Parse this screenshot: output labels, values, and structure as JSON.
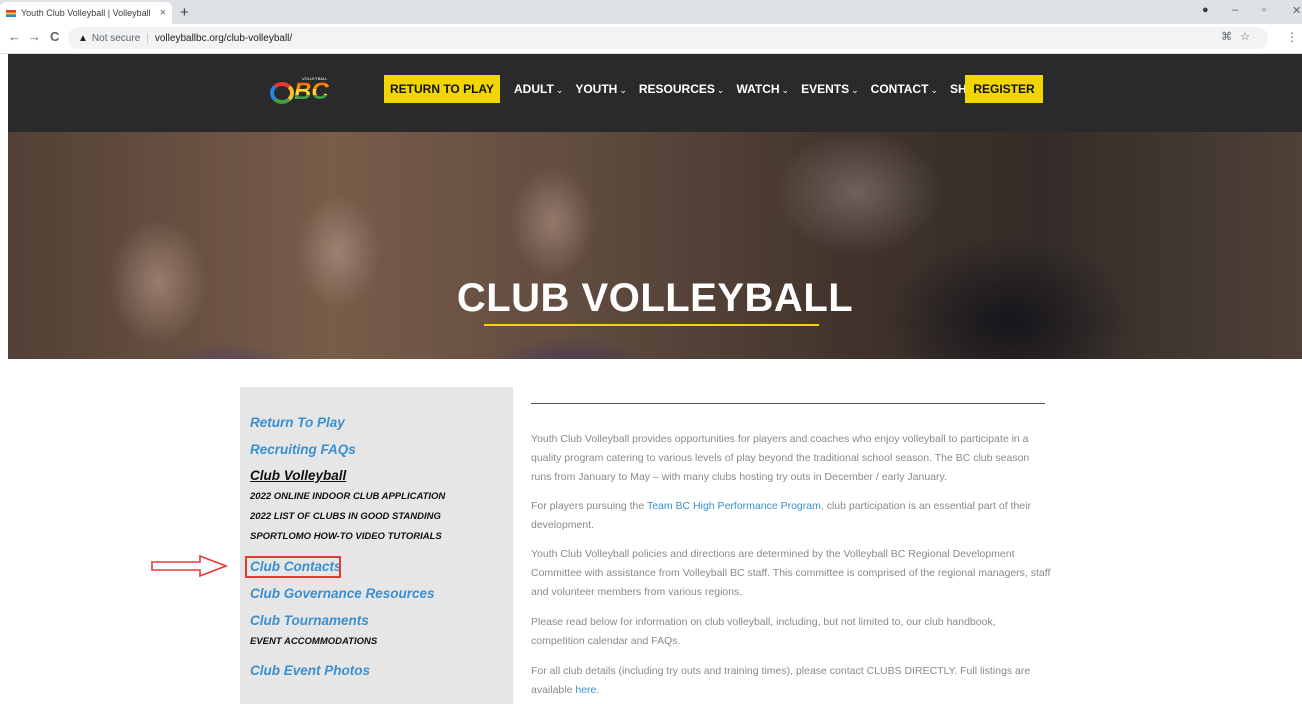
{
  "browser": {
    "tab_title": "Youth Club Volleyball | Volleyball",
    "new_tab": "+",
    "close_tab": "×",
    "not_secure": "Not secure",
    "url": "volleyballbc.org/club-volleyball/"
  },
  "header": {
    "logo_text": "BC",
    "logo_small": "VOLLEYBALL",
    "return_to_play": "RETURN TO PLAY",
    "menu": [
      {
        "label": "ADULT",
        "has_dropdown": true
      },
      {
        "label": "YOUTH",
        "has_dropdown": true
      },
      {
        "label": "RESOURCES",
        "has_dropdown": true
      },
      {
        "label": "WATCH",
        "has_dropdown": true
      },
      {
        "label": "EVENTS",
        "has_dropdown": true
      },
      {
        "label": "CONTACT",
        "has_dropdown": true
      },
      {
        "label": "SHOP",
        "has_dropdown": false
      }
    ],
    "register": "REGISTER",
    "accent_color": "#f2d600"
  },
  "hero": {
    "title": "CLUB VOLLEYBALL"
  },
  "sidebar": {
    "return_to_play": "Return To Play",
    "recruiting_faqs": "Recruiting FAQs",
    "club_volleyball": "Club Volleyball",
    "sub_application": "2022 ONLINE INDOOR CLUB APPLICATION",
    "sub_list": "2022 LIST OF CLUBS IN GOOD STANDING",
    "sub_tutorials": "SPORTLOMO HOW-TO VIDEO TUTORIALS",
    "club_contacts": "Club Contacts",
    "club_governance": "Club Governance Resources",
    "club_tournaments": "Club Tournaments",
    "sub_accommodations": "EVENT ACCOMMODATIONS",
    "club_event_photos": "Club Event Photos"
  },
  "content": {
    "p1": "Youth Club Volleyball provides opportunities for players and coaches who enjoy volleyball to participate in a quality program catering to various levels of play beyond the traditional school season. The BC club season runs from January to May – with many clubs hosting try outs in December / early January.",
    "p2_before": "For players pursuing the ",
    "p2_link": "Team BC High Performance Program",
    "p2_after": ", club participation is an essential part of their development.",
    "p3": "Youth Club Volleyball policies and directions are determined by the Volleyball BC Regional Development Committee with assistance from Volleyball BC staff. This committee is comprised of the regional managers, staff and volunteer members from various regions.",
    "p4": "Please read below for information on club volleyball, including, but not limited to, our club handbook, competition calendar and FAQs.",
    "p5_before": "For all club details (including try outs and training times), please contact CLUBS DIRECTLY. Full listings are available ",
    "p5_link": "here",
    "p5_after": "."
  },
  "icons": {
    "back": "←",
    "forward": "→",
    "reload": "C",
    "warning": "▲",
    "chevron": "⌄",
    "star": "☆",
    "menu": "⋮",
    "minimize": "–",
    "restore": "▫",
    "close": "✕"
  }
}
